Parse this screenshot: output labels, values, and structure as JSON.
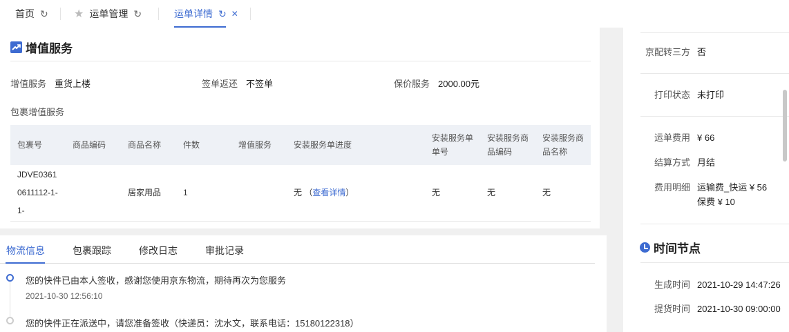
{
  "tabs": [
    {
      "label": "首页"
    },
    {
      "label": "运单管理"
    },
    {
      "label": "运单详情"
    }
  ],
  "value_added": {
    "title": "增值服务",
    "fields": [
      {
        "label": "增值服务",
        "value": "重货上楼"
      },
      {
        "label": "签单返还",
        "value": "不签单"
      },
      {
        "label": "保价服务",
        "value": "2000.00元"
      }
    ],
    "package_label": "包裹增值服务",
    "table": {
      "headers": [
        "包裹号",
        "商品编码",
        "商品名称",
        "件数",
        "增值服务",
        "安装服务单进度",
        "安装服务单单号",
        "安装服务商品编码",
        "安装服务商品名称"
      ],
      "rows": [
        {
          "package_no": "JDVE03610611112-1-1-",
          "sku": "",
          "name": "居家用品",
          "qty": "1",
          "service": "",
          "progress": "无",
          "progress_link": "查看详情",
          "order_no": "无",
          "goods_code": "无",
          "goods_name": "无"
        }
      ]
    }
  },
  "logistics": {
    "tabs": [
      "物流信息",
      "包裹跟踪",
      "修改日志",
      "审批记录"
    ],
    "events": [
      {
        "text": "您的快件已由本人签收，感谢您使用京东物流，期待再次为您服务",
        "time": "2021-10-30 12:56:10"
      },
      {
        "text": "您的快件正在派送中，请您准备签收（快递员：沈水文，联系电话：15180122318）"
      }
    ]
  },
  "side": {
    "rows": [
      {
        "label": "京配转三方",
        "value": "否"
      },
      {
        "label": "打印状态",
        "value": "未打印"
      },
      {
        "label": "运单费用",
        "value": "¥ 66"
      },
      {
        "label": "结算方式",
        "value": "月结"
      },
      {
        "label": "费用明细",
        "value": "运输费_快运 ¥ 56",
        "value2": "保费 ¥ 10"
      }
    ],
    "time_title": "时间节点",
    "times": [
      {
        "label": "生成时间",
        "value": "2021-10-29 14:47:26"
      },
      {
        "label": "提货时间",
        "value": "2021-10-30 09:00:00"
      }
    ]
  },
  "colors": {
    "accent": "#3d6bd1"
  },
  "icons": [
    "refresh-icon",
    "star-icon",
    "close-icon",
    "trend-chart-icon",
    "clock-icon"
  ]
}
